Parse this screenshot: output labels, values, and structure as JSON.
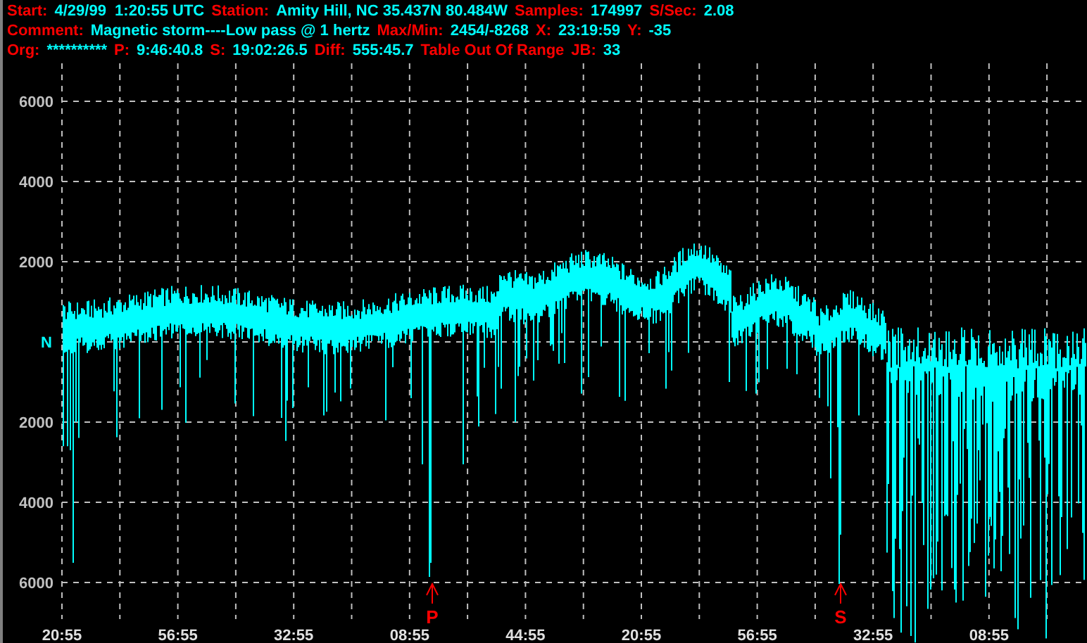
{
  "header_lines": [
    [
      {
        "kind": "label",
        "text": "Start:"
      },
      {
        "kind": "value",
        "text": "4/29/99  1:20:55 UTC"
      },
      {
        "kind": "label",
        "text": "Station:"
      },
      {
        "kind": "value",
        "text": "Amity Hill, NC 35.437N 80.484W"
      },
      {
        "kind": "label",
        "text": "Samples:"
      },
      {
        "kind": "value",
        "text": "174997"
      },
      {
        "kind": "label",
        "text": "S/Sec:"
      },
      {
        "kind": "value",
        "text": "2.08"
      }
    ],
    [
      {
        "kind": "label",
        "text": "Comment:"
      },
      {
        "kind": "value",
        "text": "Magnetic storm----Low pass @ 1 hertz"
      },
      {
        "kind": "label",
        "text": "Max/Min:"
      },
      {
        "kind": "value",
        "text": "2454/-8268"
      },
      {
        "kind": "label",
        "text": "X:"
      },
      {
        "kind": "value",
        "text": "23:19:59"
      },
      {
        "kind": "label",
        "text": "Y:"
      },
      {
        "kind": "value",
        "text": "-35"
      }
    ],
    [
      {
        "kind": "label",
        "text": "Org:"
      },
      {
        "kind": "value",
        "text": "**********"
      },
      {
        "kind": "label",
        "text": "P:"
      },
      {
        "kind": "value",
        "text": "9:46:40.8"
      },
      {
        "kind": "label",
        "text": "S:"
      },
      {
        "kind": "value",
        "text": "19:02:26.5"
      },
      {
        "kind": "label",
        "text": "Diff:"
      },
      {
        "kind": "value",
        "text": "555:45.7"
      },
      {
        "kind": "label",
        "text": "Table Out Of Range"
      },
      {
        "kind": "label",
        "text": "JB:"
      },
      {
        "kind": "value",
        "text": "33"
      }
    ]
  ],
  "y_axis": [
    {
      "kind": "number",
      "text": "6000"
    },
    {
      "kind": "number",
      "text": "4000"
    },
    {
      "kind": "number",
      "text": "2000"
    },
    {
      "kind": "zero",
      "text": "N"
    },
    {
      "kind": "number",
      "text": "2000"
    },
    {
      "kind": "number",
      "text": "4000"
    },
    {
      "kind": "number",
      "text": "6000"
    }
  ],
  "x_axis": [
    "20:55",
    "56:55",
    "32:55",
    "08:55",
    "44:55",
    "20:55",
    "56:55",
    "32:55",
    "08:55"
  ],
  "markers": [
    "P",
    "S"
  ]
}
